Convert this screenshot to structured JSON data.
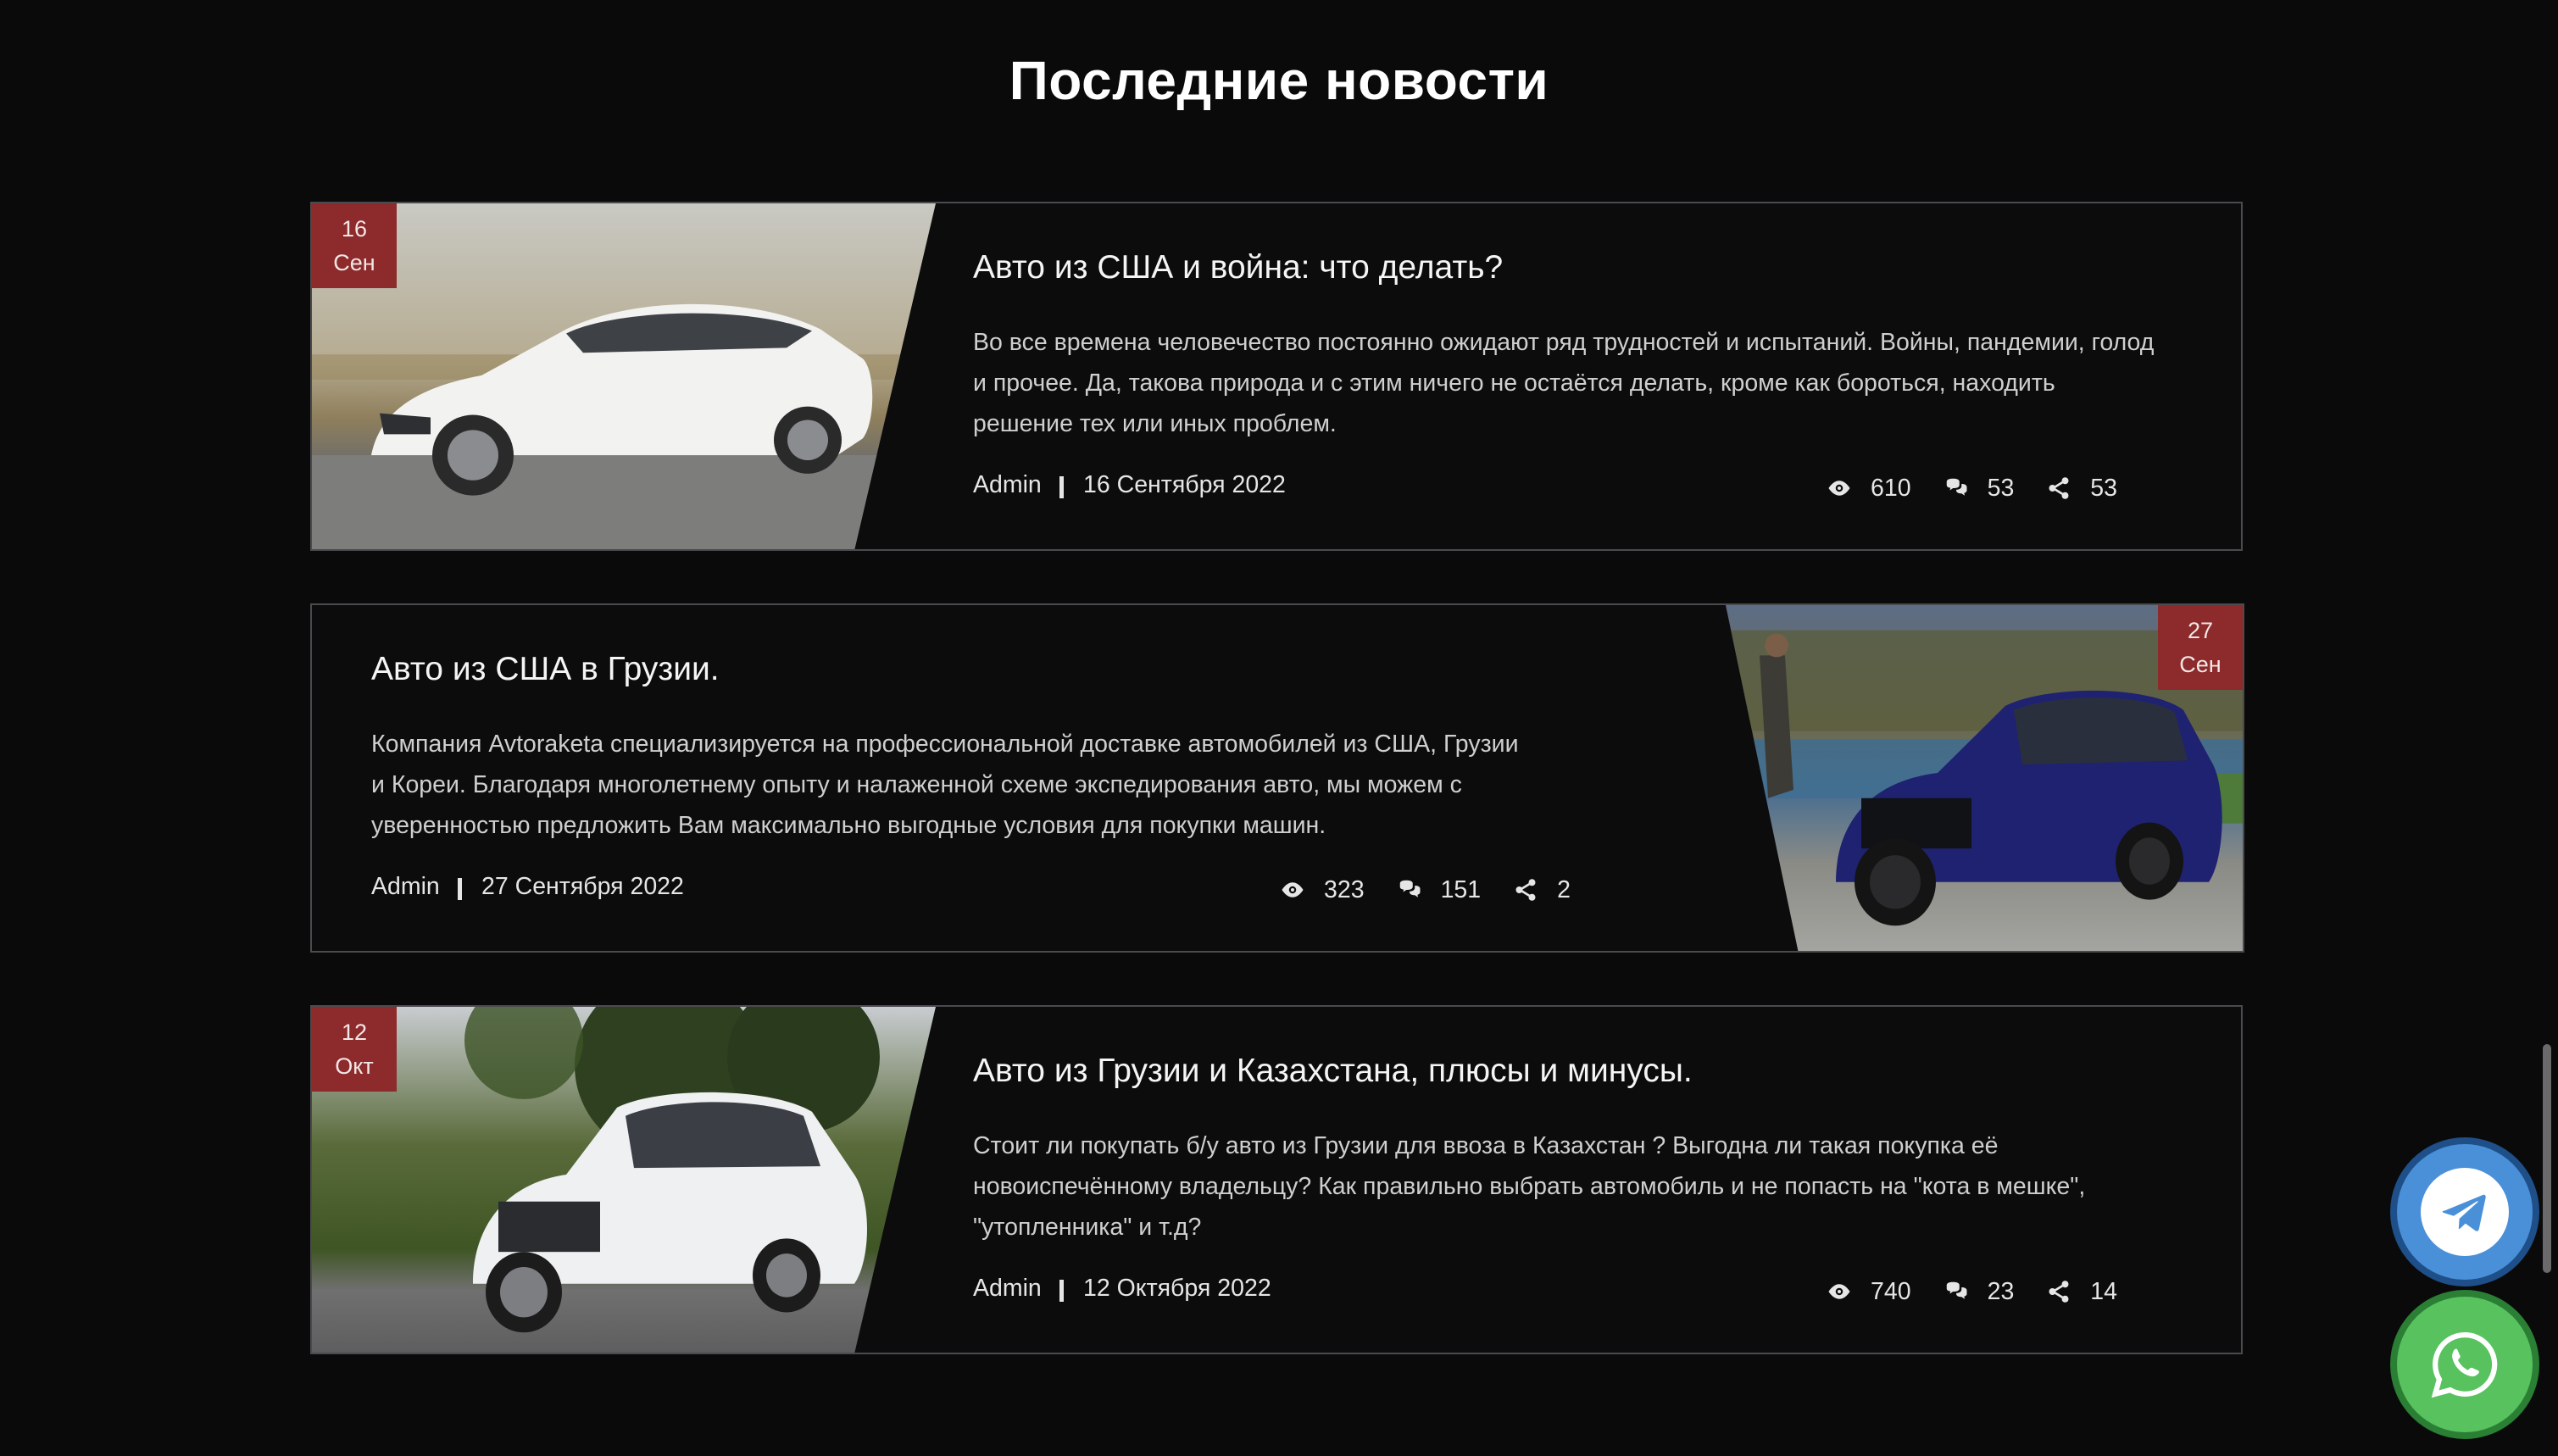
{
  "section": {
    "title": "Последние новости"
  },
  "posts": [
    {
      "day": "16",
      "month": "Сен",
      "title": "Авто из США и война: что делать?",
      "excerpt": "Во все времена человечество постоянно ожидают ряд трудностей и испытаний. Войны, пандемии, голод и прочее. Да, такова природа и с этим ничего не остаётся делать, кроме как бороться, находить решение тех или иных проблем.",
      "author": "Admin",
      "date": "16 Сентября 2022",
      "views": "610",
      "comments": "53",
      "shares": "53"
    },
    {
      "day": "27",
      "month": "Сен",
      "title": "Авто из США в Грузии.",
      "excerpt": "Компания Avtoraketa специализируется на профессиональной доставке автомобилей из США, Грузии и Кореи. Благодаря многолетнему опыту и налаженной схеме экспедирования авто, мы можем с уверенностью предложить Вам максимально выгодные условия для покупки машин.",
      "author": "Admin",
      "date": "27 Сентября 2022",
      "views": "323",
      "comments": "151",
      "shares": "2"
    },
    {
      "day": "12",
      "month": "Окт",
      "title": "Авто из Грузии и Казахстана, плюсы и минусы.",
      "excerpt": "Стоит ли покупать б/у авто из Грузии для ввоза в Казахстан ? Выгодна ли такая покупка её новоиспечённому владельцу? Как правильно выбрать автомобиль и не попасть на \"кота в мешке\", \"утопленника\" и т.д?",
      "author": "Admin",
      "date": "12 Октября 2022",
      "views": "740",
      "comments": "23",
      "shares": "14"
    }
  ],
  "icons": {
    "views": "eye-icon",
    "comments": "comments-icon",
    "shares": "share-icon",
    "telegram": "telegram-icon",
    "whatsapp": "whatsapp-icon"
  },
  "colors": {
    "background": "#0a0a0b",
    "badge": "#8d2a2b",
    "card_border": "#4a4a4f",
    "telegram": "#4a90d9",
    "whatsapp": "#57c25e"
  }
}
